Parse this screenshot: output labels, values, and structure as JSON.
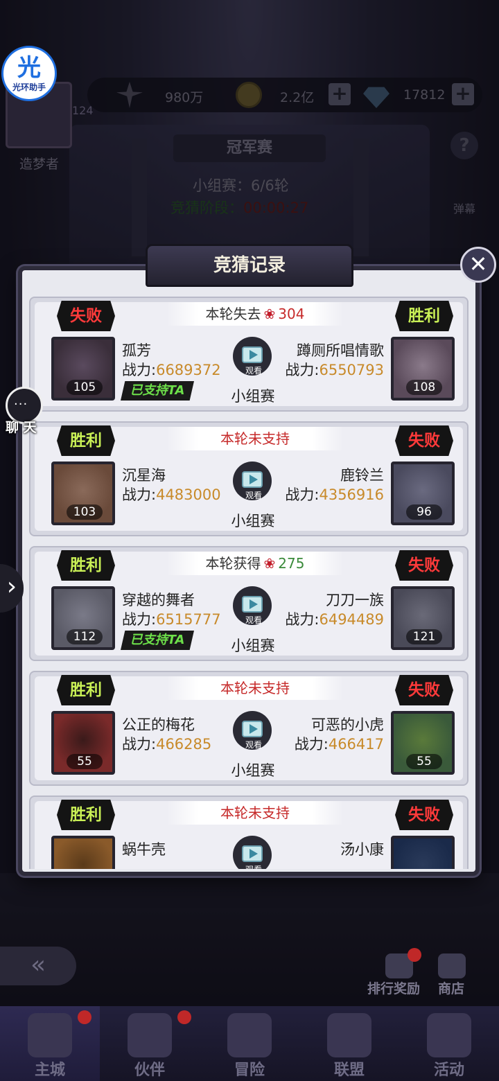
{
  "assistant": {
    "icon_char": "光",
    "label": "光环助手"
  },
  "player": {
    "level": "124",
    "name": "造梦者"
  },
  "resources": [
    {
      "name": "sword-power",
      "value": "980万"
    },
    {
      "name": "gold-coin",
      "value": "2.2亿"
    },
    {
      "name": "diamond",
      "value": "17812"
    }
  ],
  "header": {
    "title": "冠军赛",
    "stage": "小组赛：6/6轮",
    "timer_label": "竞猜阶段：",
    "timer_value": "00:00:27",
    "help": "?",
    "danmu": "弹幕"
  },
  "modal": {
    "title": "竞猜记录",
    "close": "✕",
    "watch_label": "观看",
    "power_label": "战力:",
    "supported_label": "已支持TA",
    "records": [
      {
        "banner": {
          "text": "本轮失去",
          "amount": "304",
          "type": "lost"
        },
        "left": {
          "result": "失败",
          "name": "孤芳",
          "power": "6689372",
          "level": "105",
          "supported": true
        },
        "right": {
          "result": "胜利",
          "name": "蹲厕所唱情歌",
          "power": "6550793",
          "level": "108",
          "supported": false
        },
        "match_type": "小组赛"
      },
      {
        "banner": {
          "text": "本轮未支持",
          "amount": "",
          "type": "none"
        },
        "left": {
          "result": "胜利",
          "name": "沉星海",
          "power": "4483000",
          "level": "103",
          "supported": false
        },
        "right": {
          "result": "失败",
          "name": "鹿铃兰",
          "power": "4356916",
          "level": "96",
          "supported": false
        },
        "match_type": "小组赛"
      },
      {
        "banner": {
          "text": "本轮获得",
          "amount": "275",
          "type": "gained"
        },
        "left": {
          "result": "胜利",
          "name": "穿越的舞者",
          "power": "6515777",
          "level": "112",
          "supported": true
        },
        "right": {
          "result": "失败",
          "name": "刀刀一族",
          "power": "6494489",
          "level": "121",
          "supported": false
        },
        "match_type": "小组赛"
      },
      {
        "banner": {
          "text": "本轮未支持",
          "amount": "",
          "type": "none"
        },
        "left": {
          "result": "胜利",
          "name": "公正的梅花",
          "power": "466285",
          "level": "55",
          "supported": false
        },
        "right": {
          "result": "失败",
          "name": "可恶的小虎",
          "power": "466417",
          "level": "55",
          "supported": false
        },
        "match_type": "小组赛"
      },
      {
        "banner": {
          "text": "本轮未支持",
          "amount": "",
          "type": "none"
        },
        "left": {
          "result": "胜利",
          "name": "蜗牛壳",
          "power": "",
          "level": "",
          "supported": false
        },
        "right": {
          "result": "失败",
          "name": "汤小康",
          "power": "",
          "level": "",
          "supported": false
        },
        "match_type": ""
      }
    ]
  },
  "chat": {
    "icon": "···",
    "label": "聊 天"
  },
  "bottom_buttons": {
    "ranking_reward": "排行奖励",
    "shop": "商店"
  },
  "nav": [
    {
      "label": "主城",
      "active": true,
      "badge": true
    },
    {
      "label": "伙伴",
      "active": false,
      "badge": true
    },
    {
      "label": "冒险",
      "active": false,
      "badge": false
    },
    {
      "label": "联盟",
      "active": false,
      "badge": false
    },
    {
      "label": "活动",
      "active": false,
      "badge": false
    }
  ],
  "colors": {
    "win_tag": "#c9f056",
    "lose_tag": "#ff3a3a",
    "power_value": "#c88a2a",
    "lost_amount": "#c62a2a",
    "gained_amount": "#3a8a3a",
    "supported_text": "#6de04a"
  }
}
